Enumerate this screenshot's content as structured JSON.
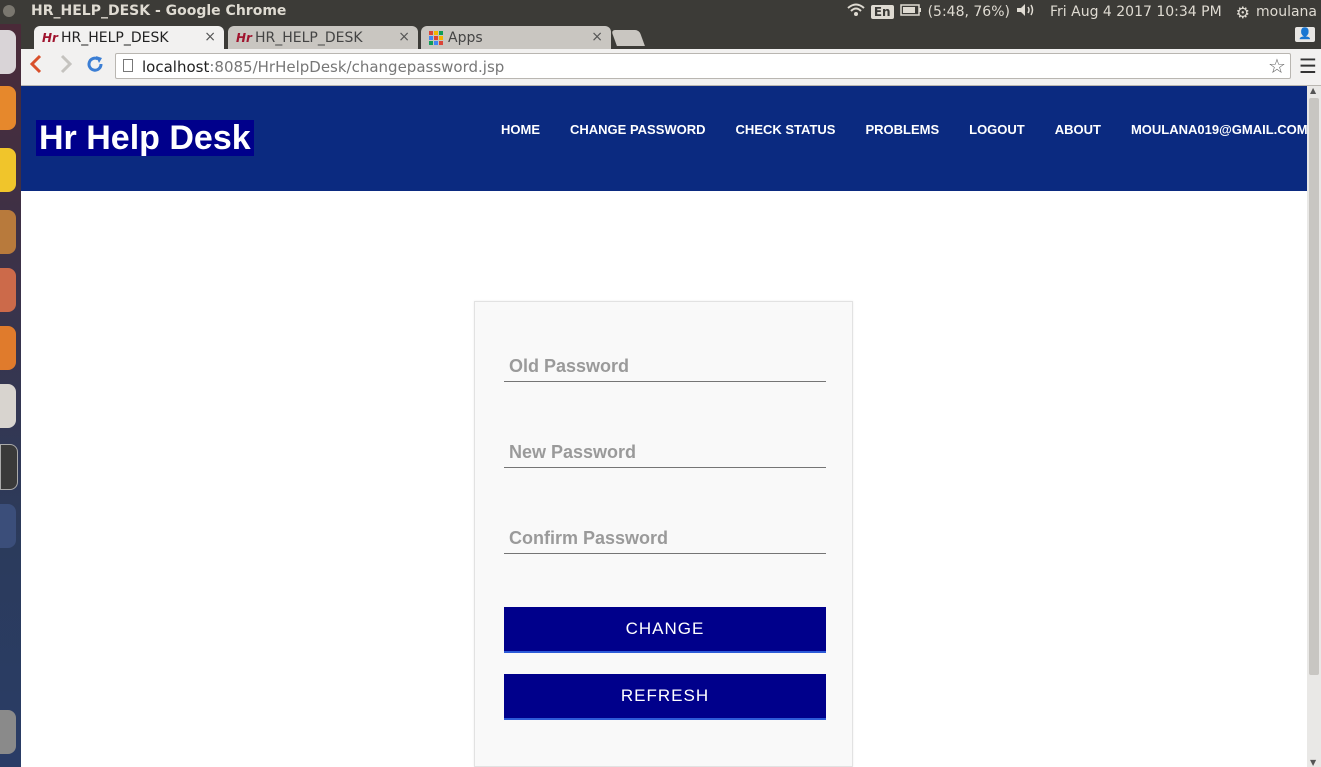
{
  "os": {
    "window_title": "HR_HELP_DESK - Google Chrome",
    "keyboard": "En",
    "battery": "(5:48, 76%)",
    "clock": "Fri Aug  4 2017 10:34 PM",
    "user": "moulana"
  },
  "browser": {
    "tabs": [
      {
        "label": "HR_HELP_DESK",
        "close": "×"
      },
      {
        "label": "HR_HELP_DESK",
        "close": "×"
      },
      {
        "label": "Apps",
        "close": "×"
      }
    ],
    "url_host": "localhost",
    "url_path": ":8085/HrHelpDesk/changepassword.jsp"
  },
  "site": {
    "brand": "Hr Help Desk",
    "nav": [
      "HOME",
      "CHANGE PASSWORD",
      "CHECK STATUS",
      "PROBLEMS",
      "LOGOUT",
      "ABOUT",
      "MOULANA019@GMAIL.COM"
    ]
  },
  "form": {
    "old_password_placeholder": "Old Password",
    "new_password_placeholder": "New Password",
    "confirm_password_placeholder": "Confirm Password",
    "change_label": "CHANGE",
    "refresh_label": "REFRESH"
  },
  "colors": {
    "header_bg": "#0b2a80",
    "button_bg": "#00008b"
  }
}
